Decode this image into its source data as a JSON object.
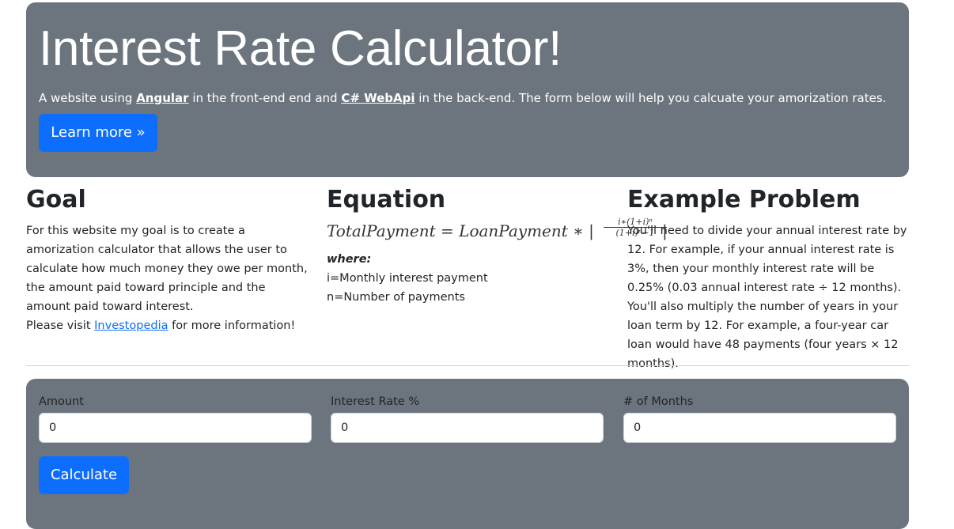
{
  "hero": {
    "title": "Interest Rate Calculator!",
    "lead_prefix": "A website using ",
    "lead_link1": "Angular",
    "lead_middle": " in the front-end end and ",
    "lead_link2": "C# WebApi",
    "lead_suffix": " in the back-end. The form below will help you calcuate your amorization rates.",
    "learn_more_label": "Learn more »"
  },
  "goal": {
    "heading": "Goal",
    "text": "For this website my goal is to create a amorization calculator that allows the user to calculate how much money they owe per month, the amount paid toward principle and the amount paid toward interest.",
    "visit_prefix": "Please visit ",
    "visit_link": "Investopedia",
    "visit_suffix": " for more information!"
  },
  "equation": {
    "heading": "Equation",
    "formula": "TotalPayment = LoanPayment ∗ |",
    "numerator": "i∗(1+i)ⁿ",
    "denominator": "(1+i)ⁿ−1",
    "closing": "|",
    "where_label": "where:",
    "def_i": "i=Monthly interest payment",
    "def_n": "n=Number of payments"
  },
  "example": {
    "heading": "Example Problem",
    "text": "You'll need to divide your annual interest rate by 12. For example, if your annual interest rate is 3%, then your monthly interest rate will be 0.25% (0.03 annual interest rate ÷ 12 months). You'll also multiply the number of years in your loan term by 12. For example, a four-year car loan would have 48 payments (four years × 12 months)."
  },
  "form": {
    "amount_label": "Amount",
    "amount_value": "0",
    "rate_label": "Interest Rate %",
    "rate_value": "0",
    "months_label": "# of Months",
    "months_value": "0",
    "calculate_label": "Calculate"
  },
  "colors": {
    "panel": "#6c757d",
    "primary": "#0d6efd"
  }
}
